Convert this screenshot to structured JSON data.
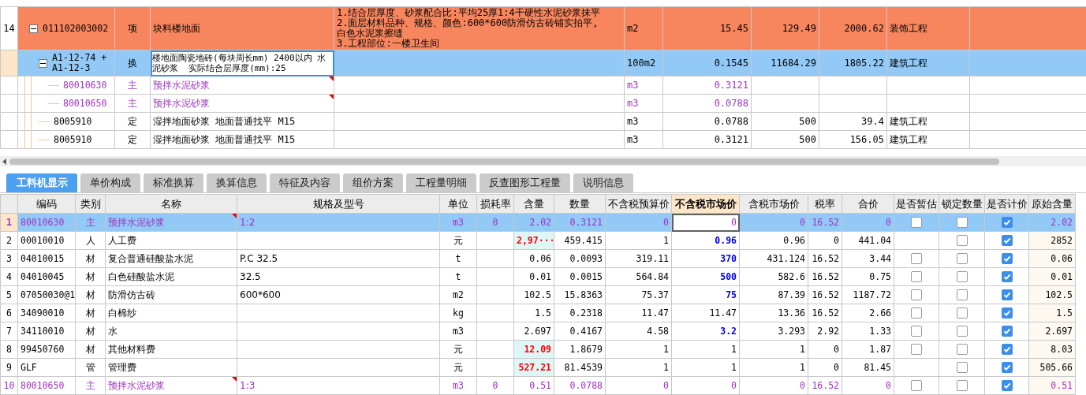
{
  "bill_grid": {
    "rows": [
      {
        "no": "14",
        "code": "011102003002",
        "type": "项",
        "name": "块料楼地面",
        "spec": "1.结合层厚度、砂浆配合比:平均25厚1:4干硬性水泥砂浆抹平\n2.面层材料品种、规格、颜色:600*600防滑仿古砖铺实拍平,\n白色水泥浆擦缝\n3.工程部位:一楼卫生间",
        "unit": "m2",
        "quantity": "15.45",
        "price": "129.49",
        "total": "2000.62",
        "category": "装饰工程",
        "kind": "bill",
        "selected": false,
        "marked": false,
        "expanded": true,
        "children": [
          {
            "code": "A1-12-74 +\nA1-12-3",
            "type": "换",
            "name": "楼地面陶瓷地砖(每块周长mm) 2400以内 水泥砂浆  实际结合层厚度(mm):25",
            "unit": "100m2",
            "quantity": "0.1545",
            "price": "11684.29",
            "total": "1805.22",
            "category": "建筑工程",
            "kind": "norm",
            "selected": true,
            "marked": false,
            "expanded": true,
            "children": [
              {
                "code": "80010630",
                "type": "主",
                "name": "预拌水泥砂浆",
                "unit": "m3",
                "quantity": "0.3121",
                "kind": "material",
                "selected": false,
                "marked": true
              },
              {
                "code": "80010650",
                "type": "主",
                "name": "预拌水泥砂浆",
                "unit": "m3",
                "quantity": "0.0788",
                "kind": "material",
                "selected": false,
                "marked": true
              }
            ]
          },
          {
            "code": "8005910",
            "type": "定",
            "name": "湿拌地面砂浆 地面普通找平 M15",
            "unit": "m3",
            "quantity": "0.0788",
            "price": "500",
            "total": "39.4",
            "category": "建筑工程",
            "kind": "norm",
            "selected": false,
            "marked": false
          },
          {
            "code": "8005910",
            "type": "定",
            "name": "湿拌地面砂浆 地面普通找平 M15",
            "unit": "m3",
            "quantity": "0.3121",
            "price": "500",
            "total": "156.05",
            "category": "建筑工程",
            "kind": "norm",
            "selected": false,
            "marked": false
          }
        ]
      }
    ]
  },
  "tabs": [
    {
      "label": "工料机显示",
      "selected": true
    },
    {
      "label": "单价构成",
      "selected": false
    },
    {
      "label": "标准换算",
      "selected": false
    },
    {
      "label": "换算信息",
      "selected": false
    },
    {
      "label": "特征及内容",
      "selected": false
    },
    {
      "label": "组价方案",
      "selected": false
    },
    {
      "label": "工程量明细",
      "selected": false
    },
    {
      "label": "反查图形工程量",
      "selected": false
    },
    {
      "label": "说明信息",
      "selected": false
    }
  ],
  "detail": {
    "columns": [
      {
        "label": "编码",
        "selected": false
      },
      {
        "label": "类别",
        "selected": false
      },
      {
        "label": "名称",
        "selected": false
      },
      {
        "label": "规格及型号",
        "selected": false
      },
      {
        "label": "单位",
        "selected": false
      },
      {
        "label": "损耗率",
        "selected": false
      },
      {
        "label": "含量",
        "selected": false
      },
      {
        "label": "数量",
        "selected": false
      },
      {
        "label": "不含税预算价",
        "selected": false
      },
      {
        "label": "不含税市场价",
        "selected": true
      },
      {
        "label": "含税市场价",
        "selected": false
      },
      {
        "label": "税率",
        "selected": false
      },
      {
        "label": "合价",
        "selected": false
      },
      {
        "label": "是否暂估",
        "selected": false
      },
      {
        "label": "锁定数量",
        "selected": false
      },
      {
        "label": "是否计价",
        "selected": false
      },
      {
        "label": "原始含量",
        "selected": false
      }
    ],
    "rows": [
      {
        "no": "1",
        "code": "80010630",
        "type": "主",
        "name": "预拌水泥砂浆",
        "spec": "1:2",
        "unit": "m3",
        "loss": "0",
        "content": "2.02",
        "quantity": "0.3121",
        "budget_price": "0",
        "market_price": "0",
        "tax_market_price": "0",
        "tax_rate": "16.52",
        "total": "0",
        "estimate": false,
        "lock": false,
        "priced": true,
        "original": "2.02",
        "kind": "main",
        "selected": true,
        "marked": true,
        "content_modified": false,
        "price_modified": false
      },
      {
        "no": "2",
        "code": "00010010",
        "type": "人",
        "name": "人工费",
        "unit": "元",
        "content": "2,97···",
        "quantity": "459.415",
        "budget_price": "1",
        "market_price": "0.96",
        "tax_market_price": "0.96",
        "tax_rate": "0",
        "total": "441.04",
        "lock": false,
        "priced": true,
        "original": "2852",
        "kind": "normal",
        "selected": false,
        "marked": false,
        "content_modified": true,
        "price_modified": true
      },
      {
        "no": "3",
        "code": "04010015",
        "type": "材",
        "name": "复合普通硅酸盐水泥",
        "spec": "P.C 32.5",
        "unit": "t",
        "content": "0.06",
        "quantity": "0.0093",
        "budget_price": "319.11",
        "market_price": "370",
        "tax_market_price": "431.124",
        "tax_rate": "16.52",
        "total": "3.44",
        "estimate": false,
        "lock": false,
        "priced": true,
        "original": "0.06",
        "kind": "normal",
        "selected": false,
        "marked": false,
        "content_modified": false,
        "price_modified": true
      },
      {
        "no": "4",
        "code": "04010045",
        "type": "材",
        "name": "白色硅酸盐水泥",
        "spec": "32.5",
        "unit": "t",
        "content": "0.01",
        "quantity": "0.0015",
        "budget_price": "564.84",
        "market_price": "500",
        "tax_market_price": "582.6",
        "tax_rate": "16.52",
        "total": "0.75",
        "estimate": false,
        "lock": false,
        "priced": true,
        "original": "0.01",
        "kind": "normal",
        "selected": false,
        "marked": false,
        "content_modified": false,
        "price_modified": true
      },
      {
        "no": "5",
        "code": "07050030@1",
        "type": "材",
        "name": "防滑仿古砖",
        "spec": "600*600",
        "unit": "m2",
        "content": "102.5",
        "quantity": "15.8363",
        "budget_price": "75.37",
        "market_price": "75",
        "tax_market_price": "87.39",
        "tax_rate": "16.52",
        "total": "1187.72",
        "estimate": false,
        "lock": false,
        "priced": true,
        "original": "102.5",
        "kind": "normal",
        "selected": false,
        "marked": false,
        "content_modified": false,
        "price_modified": true
      },
      {
        "no": "6",
        "code": "34090010",
        "type": "材",
        "name": "白棉纱",
        "unit": "kg",
        "content": "1.5",
        "quantity": "0.2318",
        "budget_price": "11.47",
        "market_price": "11.47",
        "tax_market_price": "13.36",
        "tax_rate": "16.52",
        "total": "2.66",
        "estimate": false,
        "lock": false,
        "priced": true,
        "original": "1.5",
        "kind": "normal",
        "selected": false,
        "marked": false,
        "content_modified": false,
        "price_modified": false
      },
      {
        "no": "7",
        "code": "34110010",
        "type": "材",
        "name": "水",
        "unit": "m3",
        "content": "2.697",
        "quantity": "0.4167",
        "budget_price": "4.58",
        "market_price": "3.2",
        "tax_market_price": "3.293",
        "tax_rate": "2.92",
        "total": "1.33",
        "estimate": false,
        "lock": false,
        "priced": true,
        "original": "2.697",
        "kind": "normal",
        "selected": false,
        "marked": false,
        "content_modified": false,
        "price_modified": true
      },
      {
        "no": "8",
        "code": "99450760",
        "type": "材",
        "name": "其他材料费",
        "unit": "元",
        "content": "12.09",
        "quantity": "1.8679",
        "budget_price": "1",
        "market_price": "1",
        "tax_market_price": "1",
        "tax_rate": "0",
        "total": "1.87",
        "estimate": false,
        "lock": false,
        "priced": true,
        "original": "8.03",
        "kind": "normal",
        "selected": false,
        "marked": false,
        "content_modified": true,
        "price_modified": false
      },
      {
        "no": "9",
        "code": "GLF",
        "type": "管",
        "name": "管理费",
        "unit": "元",
        "content": "527.21",
        "quantity": "81.4539",
        "budget_price": "1",
        "market_price": "1",
        "tax_market_price": "1",
        "tax_rate": "0",
        "total": "81.45",
        "lock": false,
        "priced": true,
        "original": "505.66",
        "kind": "normal",
        "selected": false,
        "marked": false,
        "content_modified": true,
        "price_modified": false
      },
      {
        "no": "10",
        "code": "80010650",
        "type": "主",
        "name": "预拌水泥砂浆",
        "spec": "1:3",
        "unit": "m3",
        "loss": "0",
        "content": "0.51",
        "quantity": "0.0788",
        "budget_price": "0",
        "market_price": "0",
        "tax_market_price": "0",
        "tax_rate": "16.52",
        "total": "0",
        "estimate": false,
        "lock": false,
        "priced": true,
        "original": "0.51",
        "kind": "main",
        "selected": false,
        "marked": true,
        "content_modified": false,
        "price_modified": false
      }
    ]
  }
}
